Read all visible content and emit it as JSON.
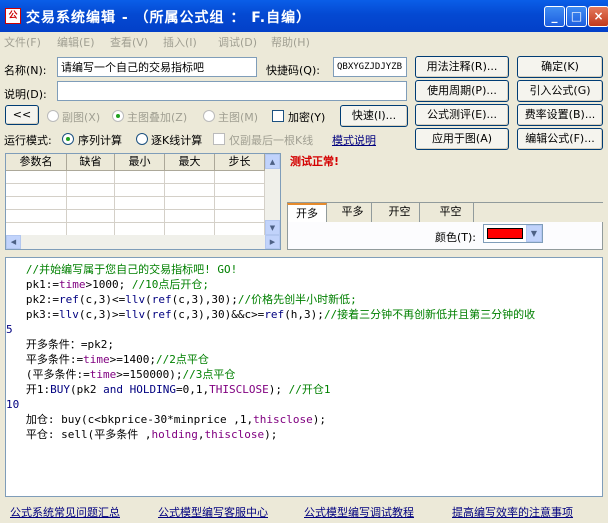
{
  "window": {
    "title": "交易系统编辑 - （所属公式组 ： F.自编）",
    "icon_name": "formula-app-icon",
    "controls": [
      "_",
      "□",
      "×"
    ]
  },
  "menu": [
    "文件(F)",
    "编辑(E)",
    "查看(V)",
    "插入(I)",
    "调试(D)",
    "帮助(H)"
  ],
  "form": {
    "name_label": "名称(N):",
    "name_value": "请编写一个自己的交易指标吧",
    "shortcut_label": "快捷码(Q):",
    "shortcut_value": "QBXYGZJDJYZB",
    "desc_label": "说明(D):",
    "desc_value": "",
    "nav_back": "<<",
    "pic_sub": "副图(X)",
    "pic_main_overlay": "主图叠加(Z)",
    "pic_main": "主图(M)",
    "encrypt": "加密(Y)",
    "fast": "快速(I)...",
    "run_mode_label": "运行模式:",
    "run_seq": "序列计算",
    "run_stepk": "逐K线计算",
    "run_last_only": "仅副最后一根K线",
    "mode_explain": "模式说明"
  },
  "buttons": {
    "usage_note": "用法注释(R)...",
    "ok": "确定(K)",
    "use_period": "使用周期(P)...",
    "import_formula": "引入公式(G)",
    "test_formula": "公式测评(E)...",
    "fee_setting": "费率设置(B)...",
    "apply_chart": "应用于图(A)",
    "edit_formula": "编辑公式(F)..."
  },
  "param_table": {
    "headers": [
      "参数名",
      "缺省",
      "最小",
      "最大",
      "步长"
    ],
    "rows": 5
  },
  "status": {
    "test_text": "测试正常!",
    "color": "#d40000"
  },
  "signal_tabs": [
    "开多",
    "平多",
    "开空",
    "平空"
  ],
  "color_picker": {
    "label": "颜色(T):",
    "value": "#ff0000"
  },
  "code": [
    [
      {
        "t": "   //并始编写属于您自己的交易指标吧! GO!",
        "c": "c"
      }
    ],
    [
      {
        "t": "   pk1:=",
        "c": ""
      },
      {
        "t": "time",
        "c": "v"
      },
      {
        "t": ">1000; ",
        "c": ""
      },
      {
        "t": "//10点后开仓;",
        "c": "c"
      }
    ],
    [
      {
        "t": "   pk2:=",
        "c": ""
      },
      {
        "t": "ref",
        "c": "k"
      },
      {
        "t": "(c,3)<=",
        "c": ""
      },
      {
        "t": "llv",
        "c": "k"
      },
      {
        "t": "(",
        "c": ""
      },
      {
        "t": "ref",
        "c": "k"
      },
      {
        "t": "(c,3),30);",
        "c": ""
      },
      {
        "t": "//价格先创半小时新低;",
        "c": "c"
      }
    ],
    [
      {
        "t": "   pk3:=",
        "c": ""
      },
      {
        "t": "llv",
        "c": "k"
      },
      {
        "t": "(c,3)>=",
        "c": ""
      },
      {
        "t": "llv",
        "c": "k"
      },
      {
        "t": "(",
        "c": ""
      },
      {
        "t": "ref",
        "c": "k"
      },
      {
        "t": "(c,3),30)&&c>=",
        "c": ""
      },
      {
        "t": "ref",
        "c": "k"
      },
      {
        "t": "(h,3);",
        "c": ""
      },
      {
        "t": "//接着三分钟不再创新低并且第三分钟的收",
        "c": "c"
      }
    ],
    [
      {
        "t": "5",
        "c": "k"
      }
    ],
    [
      {
        "t": "   开多条件：=pk2;",
        "c": ""
      }
    ],
    [
      {
        "t": "   平多条件:=",
        "c": ""
      },
      {
        "t": "time",
        "c": "v"
      },
      {
        "t": ">=1400;",
        "c": ""
      },
      {
        "t": "//2点平仓",
        "c": "c"
      }
    ],
    [
      {
        "t": "   (平多条件:=",
        "c": ""
      },
      {
        "t": "time",
        "c": "v"
      },
      {
        "t": ">=150000);",
        "c": ""
      },
      {
        "t": "//3点平仓",
        "c": "c"
      }
    ],
    [
      {
        "t": "   开1:",
        "c": ""
      },
      {
        "t": "BUY",
        "c": "k"
      },
      {
        "t": "(pk2 ",
        "c": ""
      },
      {
        "t": "and",
        "c": "k"
      },
      {
        "t": " ",
        "c": ""
      },
      {
        "t": "HOLDING",
        "c": "k"
      },
      {
        "t": "=0,1,",
        "c": ""
      },
      {
        "t": "THISCLOSE",
        "c": "v"
      },
      {
        "t": "); ",
        "c": ""
      },
      {
        "t": "//开仓1",
        "c": "c"
      }
    ],
    [
      {
        "t": "10",
        "c": "k"
      }
    ],
    [
      {
        "t": "   加仓: buy(c<bkprice-30*minprice ,1,",
        "c": ""
      },
      {
        "t": "thisclose",
        "c": "v"
      },
      {
        "t": ");",
        "c": ""
      }
    ],
    [
      {
        "t": "   平仓: sell(平多条件 ,",
        "c": ""
      },
      {
        "t": "holding",
        "c": "v"
      },
      {
        "t": ",",
        "c": ""
      },
      {
        "t": "thisclose",
        "c": "v"
      },
      {
        "t": ");",
        "c": ""
      }
    ]
  ],
  "footer_links": [
    "公式系统常见问题汇总",
    "公式模型编写客服中心",
    "公式模型编写调试教程",
    "提高编写效率的注意事项"
  ]
}
